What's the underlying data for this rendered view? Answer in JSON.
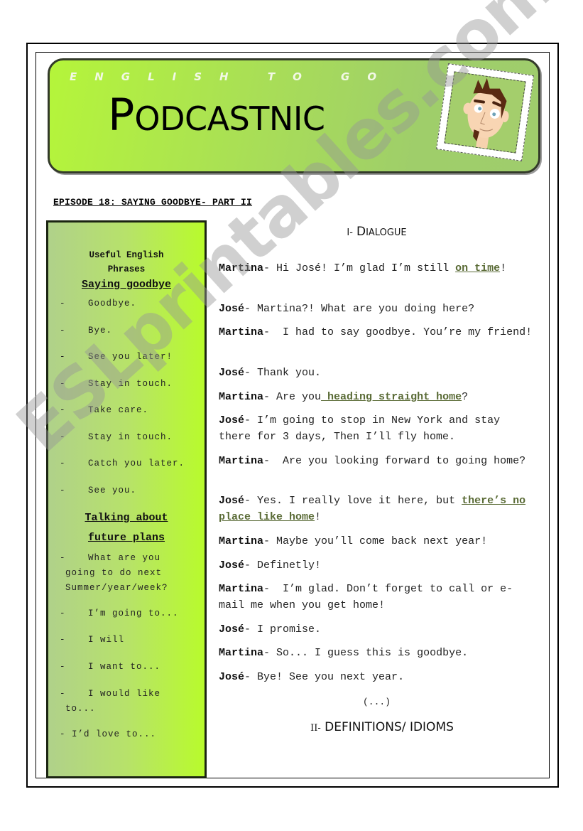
{
  "banner": {
    "subtitle": "ENGLISH TO GO",
    "title_cap": "P",
    "title_rest": "ODCASTNIC",
    "colors": {
      "green_bright": "#b5f53a",
      "green_muted": "#9fcd6c",
      "border": "#333a2a"
    }
  },
  "episode": "EPISODE 18: SAYING GOODBYE- PART II",
  "sidebar": {
    "heading_line1": "Useful English",
    "heading_line2": "Phrases",
    "section1_title": "Saying goodbye",
    "section1_items": [
      "Goodbye.",
      "Bye.",
      "See you later!",
      "Stay in touch.",
      "Take care.",
      "Stay in touch.",
      "Catch you later.",
      "See you."
    ],
    "section2_title_line1": "Talking about",
    "section2_title_line2": "future plans",
    "section2_items": [
      {
        "dash": "-",
        "lines": [
          "What are you",
          "going to do next",
          "Summer/year/week?"
        ]
      },
      {
        "dash": "-",
        "lines": [
          "I’m going to..."
        ]
      },
      {
        "dash": "-",
        "lines": [
          "I will"
        ]
      },
      {
        "dash": "-",
        "lines": [
          "I want to..."
        ]
      },
      {
        "dash": "-",
        "lines": [
          "I would like",
          "to..."
        ]
      },
      {
        "dash": "-",
        "lines": [
          "I’d love to..."
        ]
      }
    ],
    "dash": "-"
  },
  "main": {
    "section1_prefix": "I-",
    "section1_cap": "D",
    "section1_rest": "IALOGUE",
    "dialogue": [
      {
        "speaker": "Martina",
        "sep": "- ",
        "text": "Hi José! I’m glad I’m still ",
        "idiom": "on time",
        "after": "!"
      },
      {
        "speaker": "José",
        "sep": "- ",
        "text": "Martina?! What are you doing here?"
      },
      {
        "speaker": "Martina",
        "sep": "-  ",
        "text": "I had to say goodbye. You’re my friend!"
      },
      {
        "speaker": "José",
        "sep": "- ",
        "text": "Thank you."
      },
      {
        "speaker": "Martina",
        "sep": "- ",
        "text": "Are you",
        "idiom": " heading straight home",
        "after": "?"
      },
      {
        "speaker": "José",
        "sep": "- ",
        "text": "I’m going to stop in New York and stay there for 3 days, Then I’ll fly home."
      },
      {
        "speaker": "Martina",
        "sep": "-  ",
        "text": "Are you looking forward to going home?"
      },
      {
        "speaker": "José",
        "sep": "- ",
        "text": "Yes. I really love it here, but ",
        "idiom": "there’s no place like home",
        "after": "!"
      },
      {
        "speaker": "Martina",
        "sep": "- ",
        "text": "Maybe you’ll come back next year!"
      },
      {
        "speaker": "José",
        "sep": "- ",
        "text": "Definetly!"
      },
      {
        "speaker": "Martina",
        "sep": "-  ",
        "text": "I’m glad. Don’t forget to call or e-mail me when you get home!"
      },
      {
        "speaker": "José",
        "sep": "- ",
        "text": "I promise."
      },
      {
        "speaker": "Martina",
        "sep": "- ",
        "text": "So... I guess this is goodbye."
      },
      {
        "speaker": "José",
        "sep": "- ",
        "text": "Bye! See you next year."
      }
    ],
    "ellipsis": "(...)",
    "section2_prefix": "II-",
    "section2_title": " DEFINITIONS/ IDIOMS"
  },
  "watermark": "ESLprintables.com",
  "colors": {
    "idiom": "#5a6b36"
  }
}
